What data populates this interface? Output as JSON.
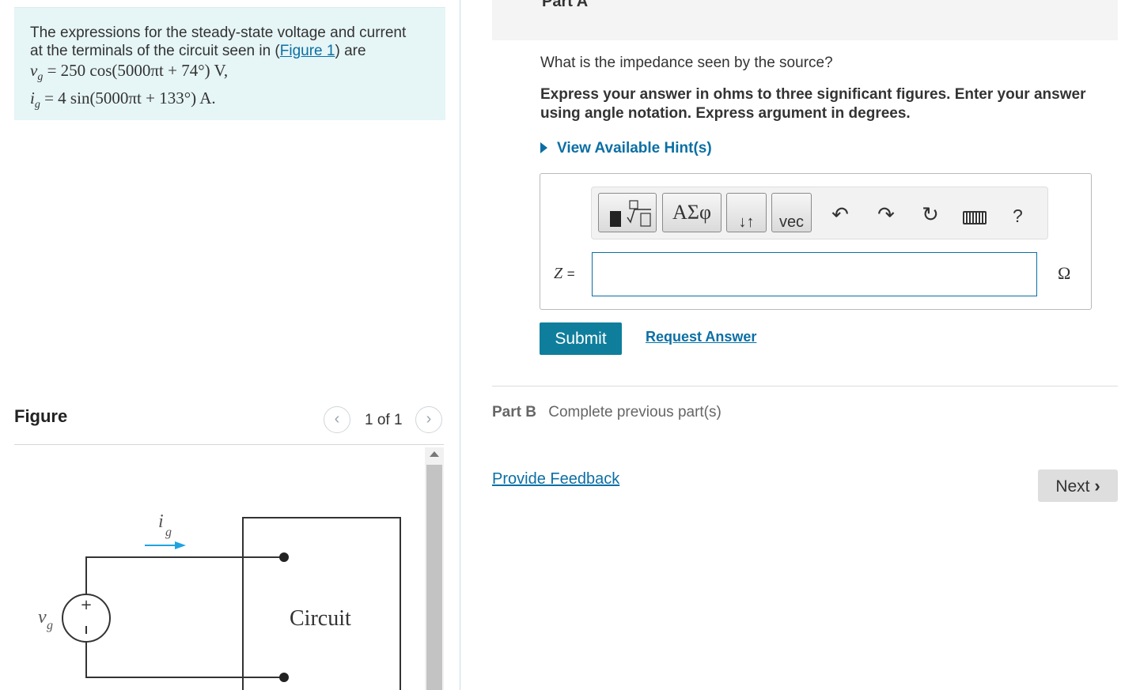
{
  "problem": {
    "intro_line1": "The expressions for the steady-state voltage and current",
    "intro_line2_prefix": "at the terminals of the circuit seen in (",
    "figure_link": "Figure 1",
    "intro_line2_suffix": ") are",
    "voltage_expr": "= 250 cos(5000πt + 74°) V,",
    "current_expr": "= 4 sin(5000πt + 133°) A."
  },
  "figure": {
    "title": "Figure",
    "pager_text": "1 of 1",
    "circuit_label": "Circuit",
    "current_label": "i",
    "current_sub": "g",
    "voltage_label": "v",
    "voltage_sub": "g"
  },
  "part_a": {
    "header": "Part A",
    "question": "What is the impedance seen by the source?",
    "instructions": "Express your answer in ohms to three significant figures. Enter your answer using angle notation. Express argument in degrees.",
    "hint_label": "View Available Hint(s)",
    "answer_label": "Z =",
    "answer_value": "",
    "unit": "Ω",
    "toolbar": {
      "greek_label": "ΑΣφ",
      "vec_label": "vec",
      "help_label": "?"
    },
    "submit_label": "Submit",
    "request_label": "Request Answer"
  },
  "part_b": {
    "label": "Part B",
    "status": "Complete previous part(s)"
  },
  "footer": {
    "feedback_label": "Provide Feedback",
    "next_label": "Next"
  },
  "colors": {
    "link": "#0b6fa4",
    "submit_bg": "#0f7e9c",
    "problem_bg": "#e6f5f6",
    "circuit_arrow": "#1fa3e0"
  }
}
